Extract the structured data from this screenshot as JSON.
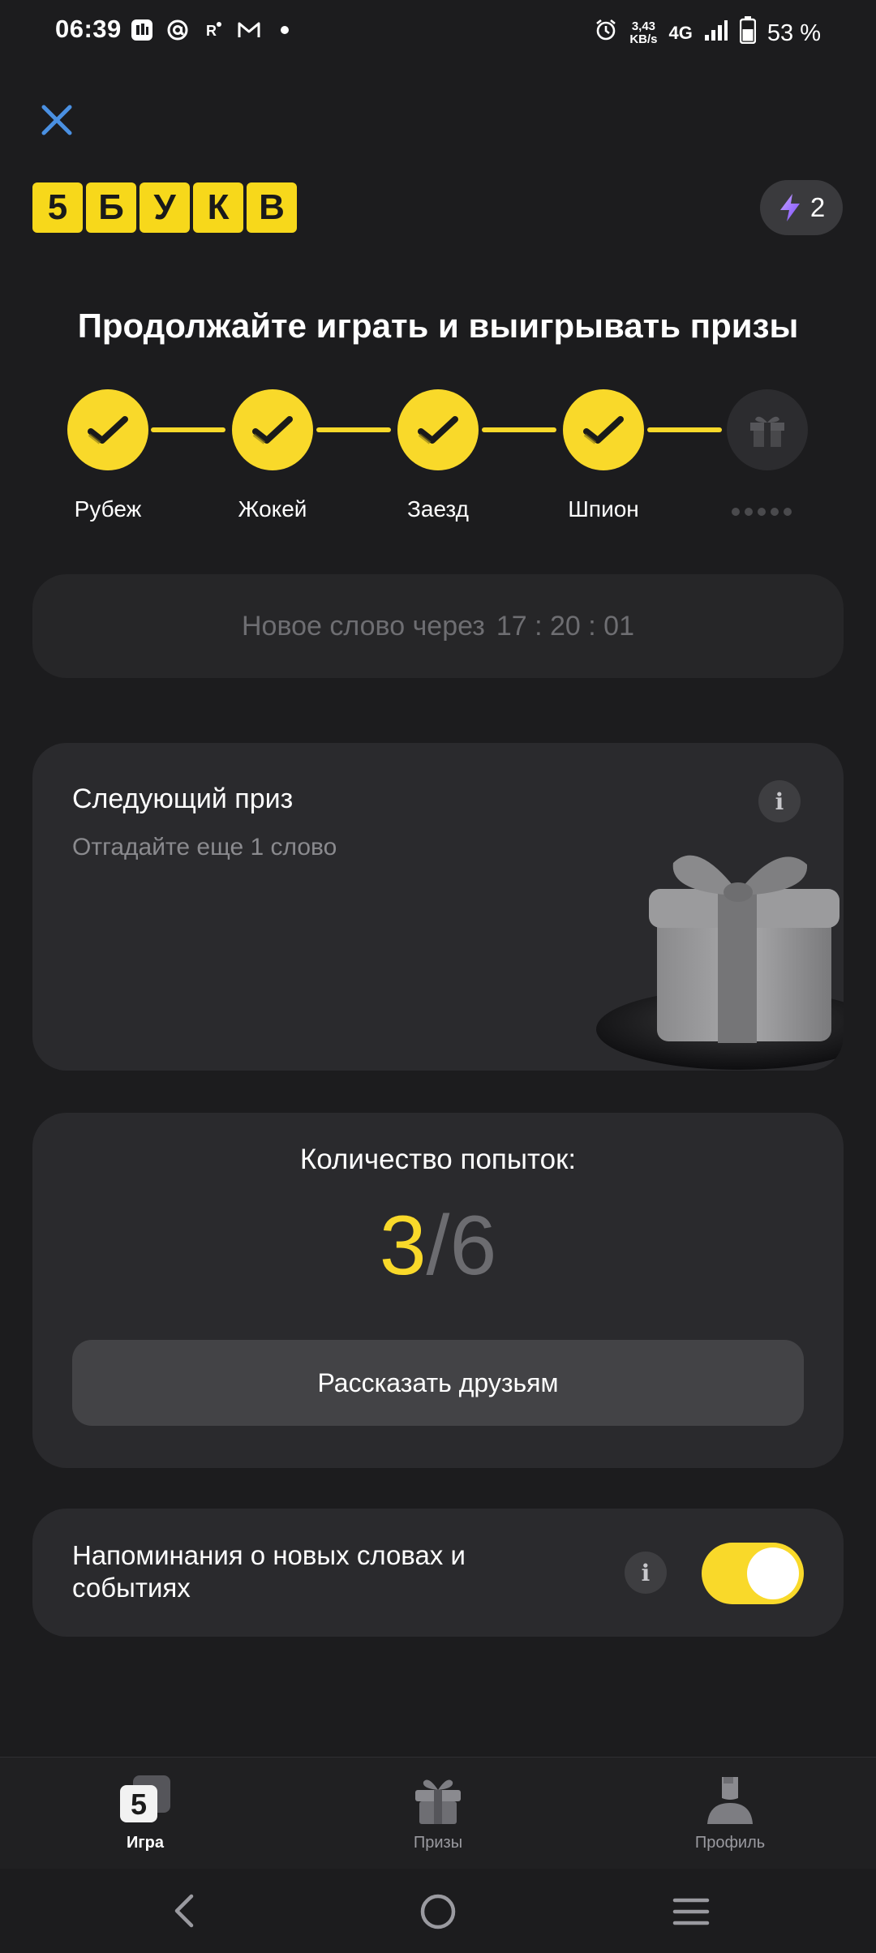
{
  "status_bar": {
    "time": "06:39",
    "speed_line1": "3,43",
    "speed_line2": "KB/s",
    "network": "4G",
    "battery": "53 %",
    "left_icons": [
      "mts-icon",
      "at-icon",
      "r-icon",
      "gmail-icon",
      "dot-icon"
    ]
  },
  "header": {
    "logo_letters": [
      "5",
      "Б",
      "У",
      "К",
      "В"
    ],
    "energy_count": "2"
  },
  "headline": "Продолжайте играть и выигрывать призы",
  "progress": {
    "steps": [
      {
        "label": "Рубеж",
        "state": "done"
      },
      {
        "label": "Жокей",
        "state": "done"
      },
      {
        "label": "Заезд",
        "state": "done"
      },
      {
        "label": "Шпион",
        "state": "done"
      },
      {
        "label": "",
        "state": "locked"
      }
    ]
  },
  "timer": {
    "label": "Новое слово через",
    "value": "17 : 20 : 01"
  },
  "prize": {
    "title": "Следующий приз",
    "subtitle": "Отгадайте еще 1 слово"
  },
  "attempts": {
    "title": "Количество попыток:",
    "used": "3",
    "separator": "/",
    "total": "6",
    "share_label": "Рассказать друзьям"
  },
  "reminder": {
    "text": "Напоминания о новых словах и событиях",
    "enabled": true
  },
  "bottom_nav": [
    {
      "label": "Игра",
      "icon": "game-icon",
      "active": true
    },
    {
      "label": "Призы",
      "icon": "gift-icon",
      "active": false
    },
    {
      "label": "Профиль",
      "icon": "profile-icon",
      "active": false
    }
  ],
  "colors": {
    "accent": "#f9d92a",
    "background": "#1c1c1e",
    "card": "#2a2a2d"
  }
}
